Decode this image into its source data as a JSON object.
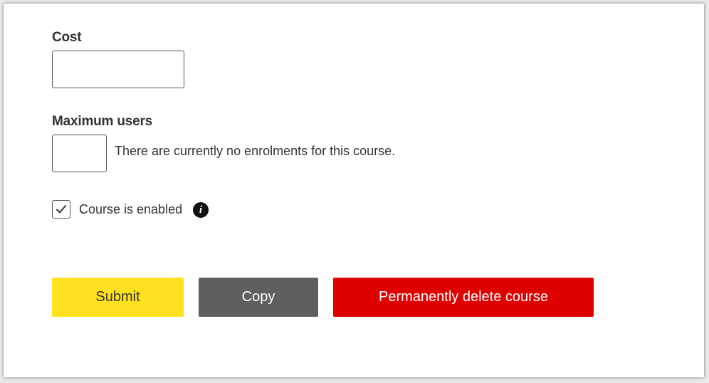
{
  "form": {
    "cost": {
      "label": "Cost",
      "value": ""
    },
    "max_users": {
      "label": "Maximum users",
      "value": "",
      "helper": "There are currently no enrolments for this course."
    },
    "enabled": {
      "label": "Course is enabled",
      "checked": true,
      "info_icon": "info-icon"
    }
  },
  "buttons": {
    "submit": "Submit",
    "copy": "Copy",
    "delete": "Permanently delete course"
  },
  "colors": {
    "submit": "#ffe11f",
    "copy": "#5f5f5f",
    "delete": "#df0000",
    "text": "#333333"
  }
}
